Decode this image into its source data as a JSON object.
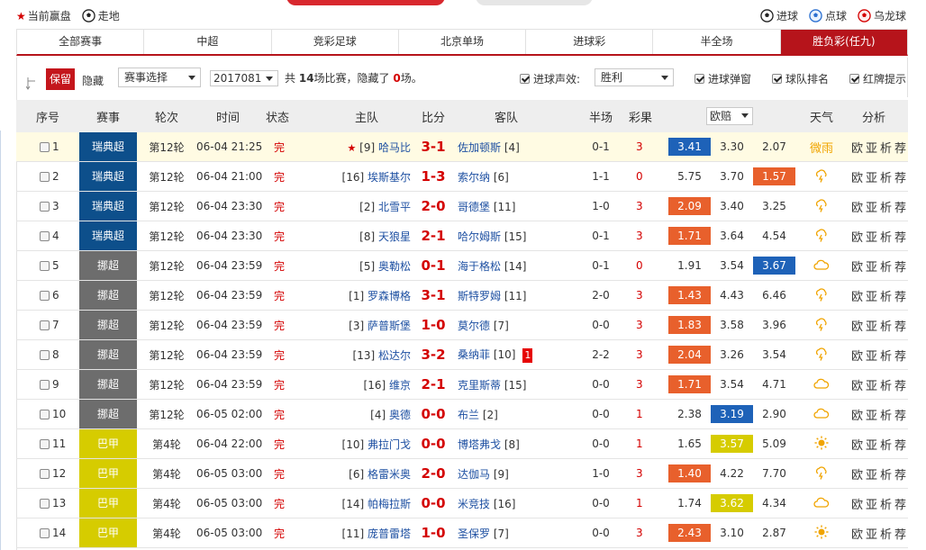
{
  "topbar": {
    "current_label": "当前赢盘",
    "walk_label": "走地",
    "goal_label": "进球",
    "penalty_label": "点球",
    "own_goal_label": "乌龙球"
  },
  "tabs": [
    {
      "label": "全部赛事",
      "active": false
    },
    {
      "label": "中超",
      "active": false
    },
    {
      "label": "竞彩足球",
      "active": false
    },
    {
      "label": "北京单场",
      "active": false
    },
    {
      "label": "进球彩",
      "active": false
    },
    {
      "label": "半全场",
      "active": false
    },
    {
      "label": "胜负彩(任九)",
      "active": true
    }
  ],
  "filters": {
    "keep_label": "保留",
    "hide_label": "隐藏",
    "league_select": "赛事选择",
    "issue_select": "2017081",
    "summary_pre": "共",
    "total_count": "14",
    "summary_mid": "场比赛，隐藏了",
    "hidden_count": "0",
    "summary_post": "场。",
    "goal_sound_label": "进球声效:",
    "sound_select": "胜利",
    "goal_popup_label": "进球弹窗",
    "team_rank_label": "球队排名",
    "card_tip_label": "红牌提示"
  },
  "headers": {
    "no": "序号",
    "league": "赛事",
    "round": "轮次",
    "time": "时间",
    "status": "状态",
    "home": "主队",
    "score": "比分",
    "away": "客队",
    "half": "半场",
    "result": "彩果",
    "odds": "欧赔",
    "weather": "天气",
    "analysis": "分析"
  },
  "colors": {
    "swe": "#0d4f8b",
    "nor": "#6d6d6d",
    "bra": "#d6cc00",
    "odds_red": "#e8602c",
    "odds_blue": "#1e62b8",
    "odds_yellow": "#d6cc00",
    "weather": "#f0a400"
  },
  "matches": [
    {
      "no": "1",
      "league": "瑞典超",
      "lc": "swe",
      "round": "第12轮",
      "time": "06-04 21:25",
      "status": "完",
      "home_star": "★",
      "home_rank": "[9]",
      "home": "哈马比",
      "score": "3-1",
      "away": "佐加顿斯",
      "away_rank": "[4]",
      "card": "",
      "half": "0-1",
      "result": "3",
      "o1": "3.41",
      "o2": "3.30",
      "o3": "2.07",
      "hot": 1,
      "hot_color": "odds_blue",
      "weather": "微雨",
      "wx_icon": "",
      "analysis": "欧亚析荐"
    },
    {
      "no": "2",
      "league": "瑞典超",
      "lc": "swe",
      "round": "第12轮",
      "time": "06-04 21:00",
      "status": "完",
      "home_star": "",
      "home_rank": "[16]",
      "home": "埃斯基尔",
      "score": "1-3",
      "away": "索尔纳",
      "away_rank": "[6]",
      "card": "",
      "half": "1-1",
      "result": "0",
      "o1": "5.75",
      "o2": "3.70",
      "o3": "1.57",
      "hot": 3,
      "hot_color": "odds_red",
      "weather": "",
      "wx_icon": "thunder-icon",
      "analysis": "欧亚析荐"
    },
    {
      "no": "3",
      "league": "瑞典超",
      "lc": "swe",
      "round": "第12轮",
      "time": "06-04 23:30",
      "status": "完",
      "home_star": "",
      "home_rank": "[2]",
      "home": "北雪平",
      "score": "2-0",
      "away": "哥德堡",
      "away_rank": "[11]",
      "card": "",
      "half": "1-0",
      "result": "3",
      "o1": "2.09",
      "o2": "3.40",
      "o3": "3.25",
      "hot": 1,
      "hot_color": "odds_red",
      "weather": "",
      "wx_icon": "thunder-icon",
      "analysis": "欧亚析荐"
    },
    {
      "no": "4",
      "league": "瑞典超",
      "lc": "swe",
      "round": "第12轮",
      "time": "06-04 23:30",
      "status": "完",
      "home_star": "",
      "home_rank": "[8]",
      "home": "天狼星",
      "score": "2-1",
      "away": "哈尔姆斯",
      "away_rank": "[15]",
      "card": "",
      "half": "0-1",
      "result": "3",
      "o1": "1.71",
      "o2": "3.64",
      "o3": "4.54",
      "hot": 1,
      "hot_color": "odds_red",
      "weather": "",
      "wx_icon": "thunder-icon",
      "analysis": "欧亚析荐"
    },
    {
      "no": "5",
      "league": "挪超",
      "lc": "nor",
      "round": "第12轮",
      "time": "06-04 23:59",
      "status": "完",
      "home_star": "",
      "home_rank": "[5]",
      "home": "奥勒松",
      "score": "0-1",
      "away": "海于格松",
      "away_rank": "[14]",
      "card": "",
      "half": "0-1",
      "result": "0",
      "o1": "1.91",
      "o2": "3.54",
      "o3": "3.67",
      "hot": 3,
      "hot_color": "odds_blue",
      "weather": "",
      "wx_icon": "cloud-icon",
      "analysis": "欧亚析荐"
    },
    {
      "no": "6",
      "league": "挪超",
      "lc": "nor",
      "round": "第12轮",
      "time": "06-04 23:59",
      "status": "完",
      "home_star": "",
      "home_rank": "[1]",
      "home": "罗森博格",
      "score": "3-1",
      "away": "斯特罗姆",
      "away_rank": "[11]",
      "card": "",
      "half": "2-0",
      "result": "3",
      "o1": "1.43",
      "o2": "4.43",
      "o3": "6.46",
      "hot": 1,
      "hot_color": "odds_red",
      "weather": "",
      "wx_icon": "thunder-icon",
      "analysis": "欧亚析荐"
    },
    {
      "no": "7",
      "league": "挪超",
      "lc": "nor",
      "round": "第12轮",
      "time": "06-04 23:59",
      "status": "完",
      "home_star": "",
      "home_rank": "[3]",
      "home": "萨普斯堡",
      "score": "1-0",
      "away": "莫尔德",
      "away_rank": "[7]",
      "card": "",
      "half": "0-0",
      "result": "3",
      "o1": "1.83",
      "o2": "3.58",
      "o3": "3.96",
      "hot": 1,
      "hot_color": "odds_red",
      "weather": "",
      "wx_icon": "thunder-icon",
      "analysis": "欧亚析荐"
    },
    {
      "no": "8",
      "league": "挪超",
      "lc": "nor",
      "round": "第12轮",
      "time": "06-04 23:59",
      "status": "完",
      "home_star": "",
      "home_rank": "[13]",
      "home": "松达尔",
      "score": "3-2",
      "away": "桑纳菲",
      "away_rank": "[10]",
      "card": "1",
      "half": "2-2",
      "result": "3",
      "o1": "2.04",
      "o2": "3.26",
      "o3": "3.54",
      "hot": 1,
      "hot_color": "odds_red",
      "weather": "",
      "wx_icon": "thunder-icon",
      "analysis": "欧亚析荐"
    },
    {
      "no": "9",
      "league": "挪超",
      "lc": "nor",
      "round": "第12轮",
      "time": "06-04 23:59",
      "status": "完",
      "home_star": "",
      "home_rank": "[16]",
      "home": "维京",
      "score": "2-1",
      "away": "克里斯蒂",
      "away_rank": "[15]",
      "card": "",
      "half": "0-0",
      "result": "3",
      "o1": "1.71",
      "o2": "3.54",
      "o3": "4.71",
      "hot": 1,
      "hot_color": "odds_red",
      "weather": "",
      "wx_icon": "cloud-icon",
      "analysis": "欧亚析荐"
    },
    {
      "no": "10",
      "league": "挪超",
      "lc": "nor",
      "round": "第12轮",
      "time": "06-05 02:00",
      "status": "完",
      "home_star": "",
      "home_rank": "[4]",
      "home": "奥德",
      "score": "0-0",
      "away": "布兰",
      "away_rank": "[2]",
      "card": "",
      "half": "0-0",
      "result": "1",
      "o1": "2.38",
      "o2": "3.19",
      "o3": "2.90",
      "hot": 2,
      "hot_color": "odds_blue",
      "weather": "",
      "wx_icon": "cloud-icon",
      "analysis": "欧亚析荐"
    },
    {
      "no": "11",
      "league": "巴甲",
      "lc": "bra",
      "round": "第4轮",
      "time": "06-04 22:00",
      "status": "完",
      "home_star": "",
      "home_rank": "[10]",
      "home": "弗拉门戈",
      "score": "0-0",
      "away": "博塔弗戈",
      "away_rank": "[8]",
      "card": "",
      "half": "0-0",
      "result": "1",
      "o1": "1.65",
      "o2": "3.57",
      "o3": "5.09",
      "hot": 2,
      "hot_color": "odds_yellow",
      "weather": "",
      "wx_icon": "sun-icon",
      "analysis": "欧亚析荐"
    },
    {
      "no": "12",
      "league": "巴甲",
      "lc": "bra",
      "round": "第4轮",
      "time": "06-05 03:00",
      "status": "完",
      "home_star": "",
      "home_rank": "[6]",
      "home": "格雷米奥",
      "score": "2-0",
      "away": "达伽马",
      "away_rank": "[9]",
      "card": "",
      "half": "1-0",
      "result": "3",
      "o1": "1.40",
      "o2": "4.22",
      "o3": "7.70",
      "hot": 1,
      "hot_color": "odds_red",
      "weather": "",
      "wx_icon": "thunder-icon",
      "analysis": "欧亚析荐"
    },
    {
      "no": "13",
      "league": "巴甲",
      "lc": "bra",
      "round": "第4轮",
      "time": "06-05 03:00",
      "status": "完",
      "home_star": "",
      "home_rank": "[14]",
      "home": "帕梅拉斯",
      "score": "0-0",
      "away": "米竞技",
      "away_rank": "[16]",
      "card": "",
      "half": "0-0",
      "result": "1",
      "o1": "1.74",
      "o2": "3.62",
      "o3": "4.34",
      "hot": 2,
      "hot_color": "odds_yellow",
      "weather": "",
      "wx_icon": "cloud-icon",
      "analysis": "欧亚析荐"
    },
    {
      "no": "14",
      "league": "巴甲",
      "lc": "bra",
      "round": "第4轮",
      "time": "06-05 03:00",
      "status": "完",
      "home_star": "",
      "home_rank": "[11]",
      "home": "庞普雷塔",
      "score": "1-0",
      "away": "圣保罗",
      "away_rank": "[7]",
      "card": "",
      "half": "0-0",
      "result": "3",
      "o1": "2.43",
      "o2": "3.10",
      "o3": "2.87",
      "hot": 1,
      "hot_color": "odds_red",
      "weather": "",
      "wx_icon": "sun-icon",
      "analysis": "欧亚析荐"
    }
  ]
}
